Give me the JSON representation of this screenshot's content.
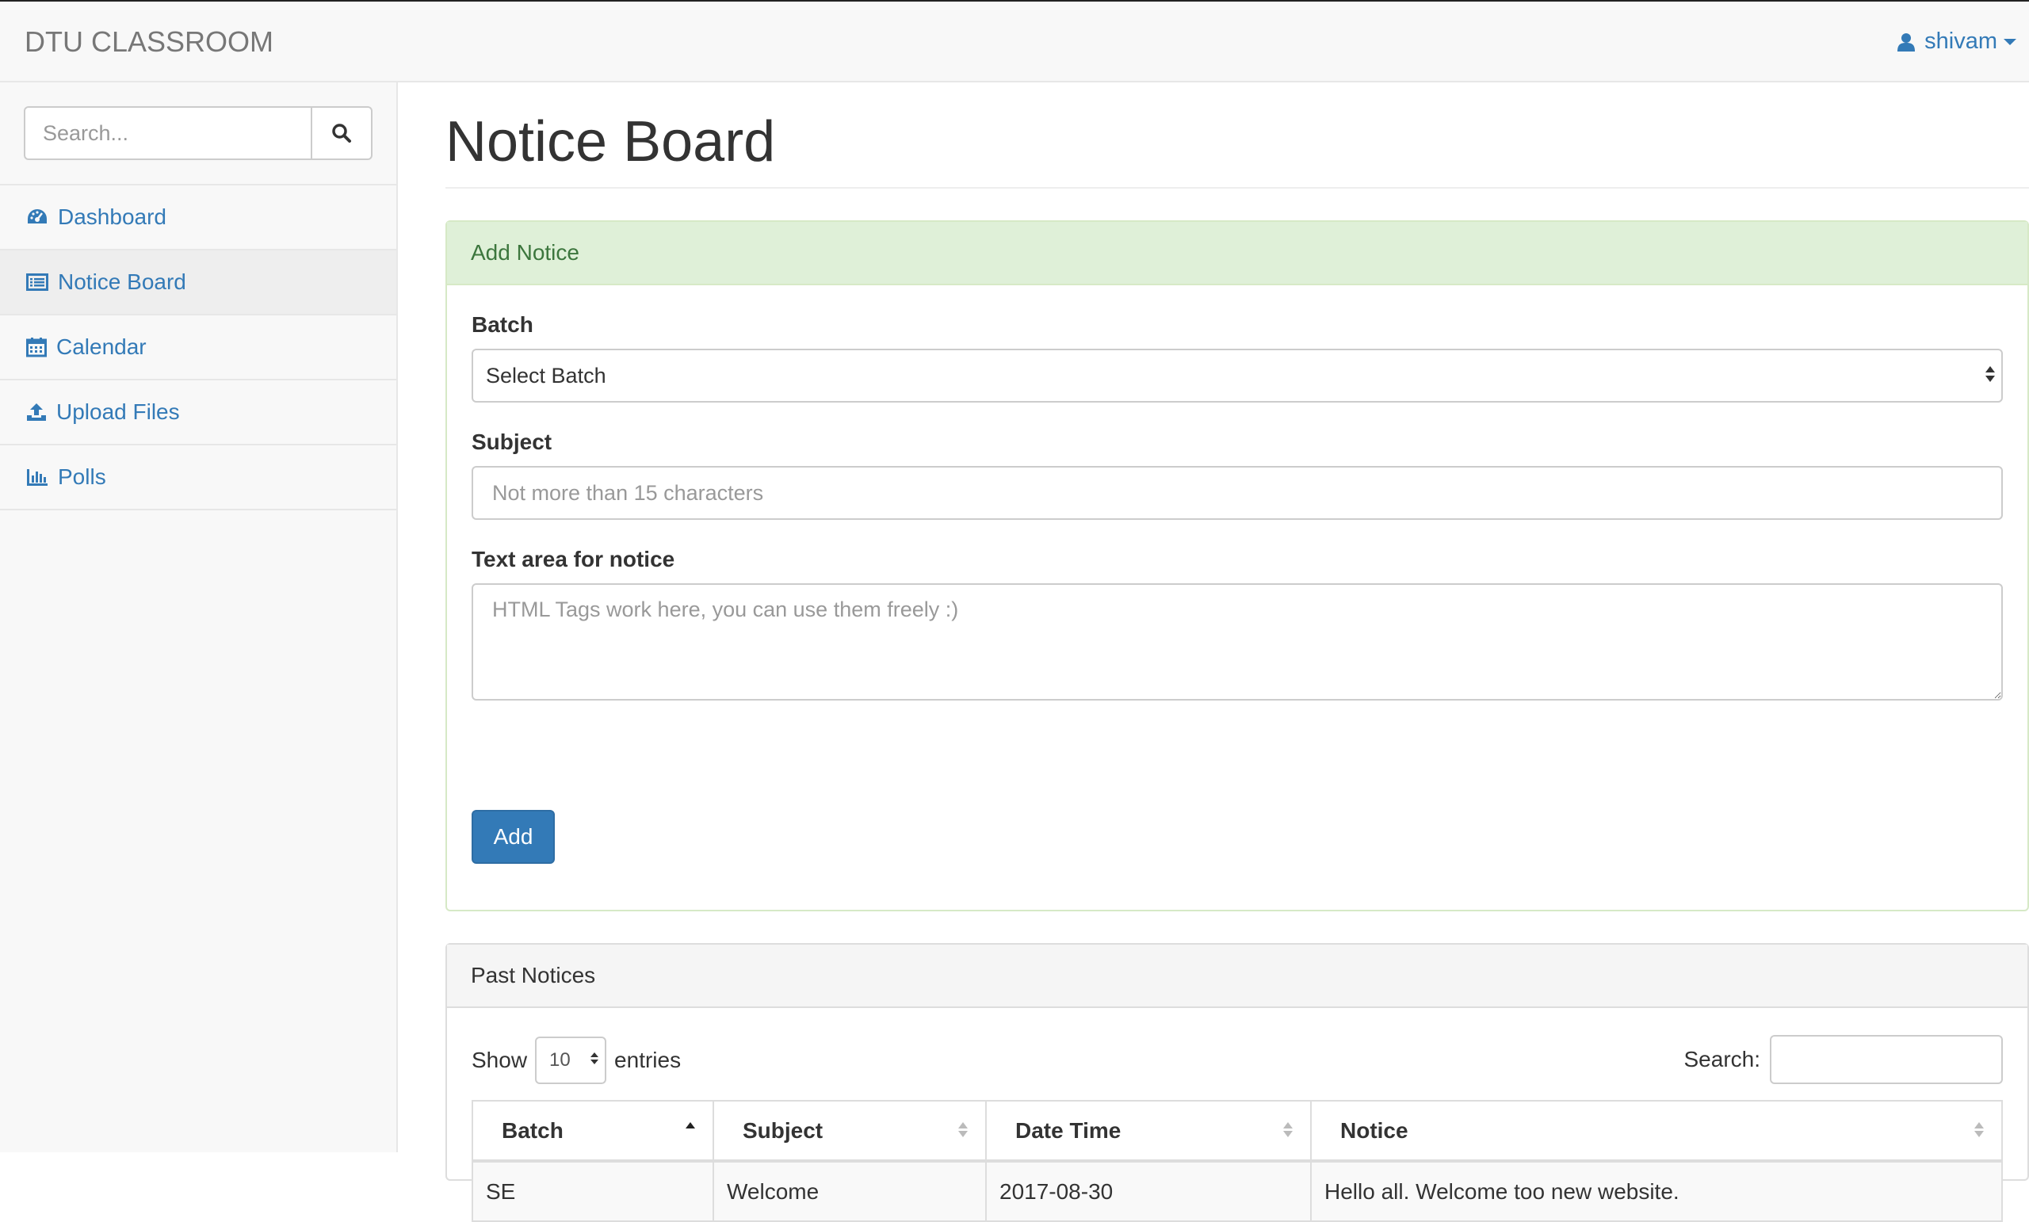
{
  "navbar": {
    "brand": "DTU CLASSROOM",
    "user": "shivam"
  },
  "sidebar": {
    "search_placeholder": "Search...",
    "items": [
      {
        "label": "Dashboard",
        "icon": "dashboard-icon"
      },
      {
        "label": "Notice Board",
        "icon": "list-alt-icon",
        "active": true
      },
      {
        "label": "Calendar",
        "icon": "calendar-icon"
      },
      {
        "label": "Upload Files",
        "icon": "upload-icon"
      },
      {
        "label": "Polls",
        "icon": "bar-chart-icon"
      }
    ]
  },
  "main": {
    "title": "Notice Board",
    "add_panel": {
      "heading": "Add Notice",
      "batch_label": "Batch",
      "batch_value": "Select Batch",
      "subject_label": "Subject",
      "subject_placeholder": "Not more than 15 characters",
      "notice_label": "Text area for notice",
      "notice_placeholder": "HTML Tags work here, you can use them freely :)",
      "add_button": "Add"
    },
    "past_panel": {
      "heading": "Past Notices",
      "show_label": "Show",
      "page_length": "10",
      "entries_label": "entries",
      "search_label": "Search:",
      "columns": [
        "Batch",
        "Subject",
        "Date Time",
        "Notice"
      ],
      "rows": [
        [
          "SE",
          "Welcome",
          "2017-08-30",
          "Hello all. Welcome too new website."
        ]
      ]
    }
  },
  "colors": {
    "link": "#337ab7",
    "success_bg": "#dff0d8",
    "success_text": "#3c763d",
    "primary": "#337ab7"
  }
}
